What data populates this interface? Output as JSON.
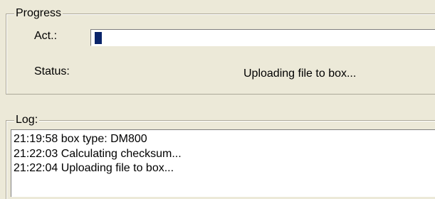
{
  "progress": {
    "legend": "Progress",
    "act_label": "Act.:",
    "act_fraction": 0.019,
    "status_label": "Status:",
    "status_value": "Uploading file to box..."
  },
  "log": {
    "legend": "Log:",
    "lines": [
      "21:19:58 box type: DM800",
      "21:22:03 Calculating checksum...",
      "21:22:04 Uploading file to box..."
    ]
  }
}
